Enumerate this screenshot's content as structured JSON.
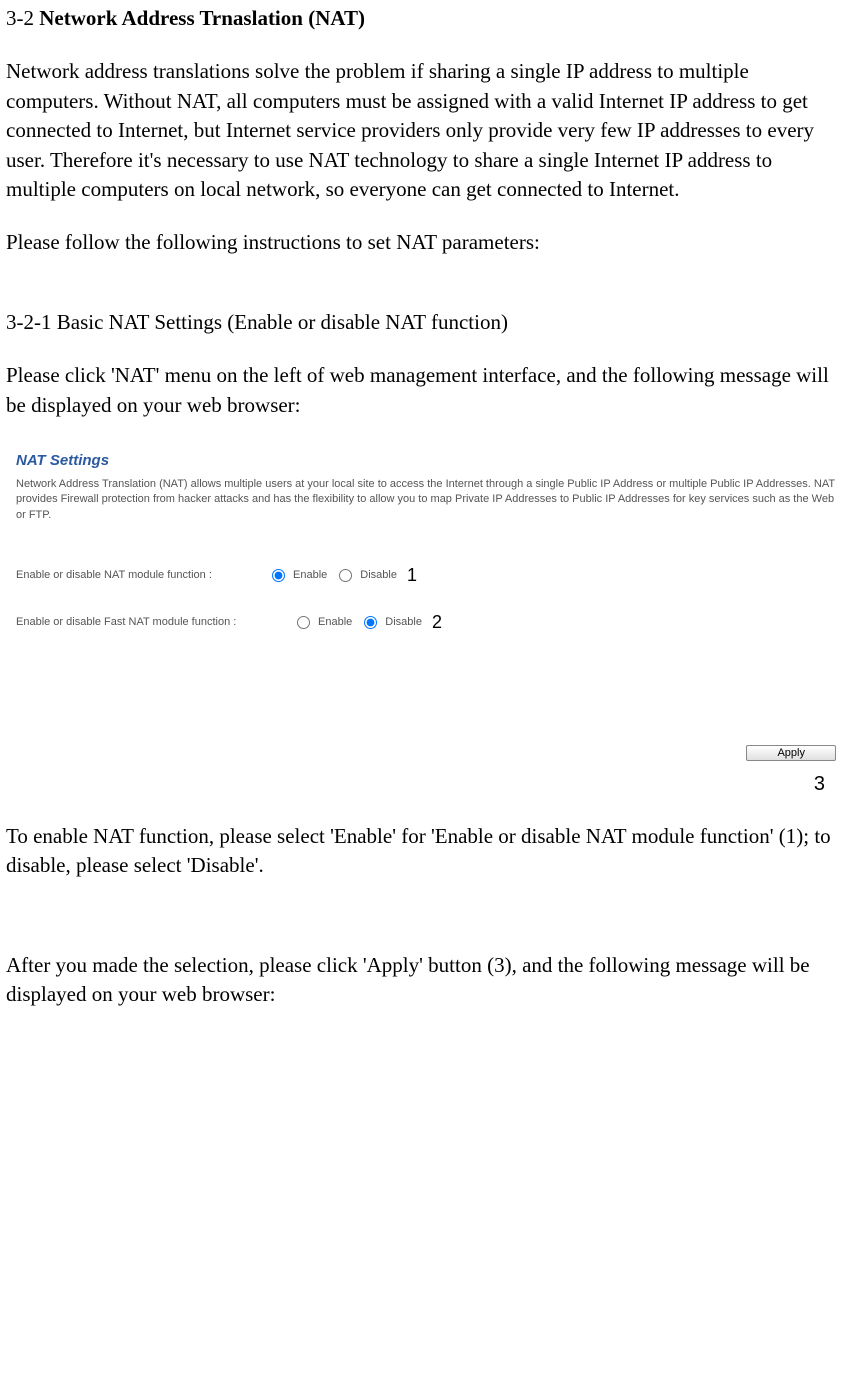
{
  "heading": {
    "number": "3-2 ",
    "title": "Network Address Trnaslation (NAT)"
  },
  "para1": "Network address translations solve the problem if sharing a single IP address to multiple computers. Without NAT, all computers must be assigned with a valid Internet IP address to get connected to Internet, but Internet service providers only provide very few IP addresses to every user. Therefore it's necessary to use NAT technology to share a single Internet IP address to multiple computers on local network, so everyone can get connected to Internet.",
  "para2": "Please follow the following instructions to set NAT parameters:",
  "subheading": "3-2-1 Basic NAT Settings (Enable or disable NAT function)",
  "para3": "Please click 'NAT' menu on the left of web management interface, and the following message will be displayed on your web browser:",
  "screenshot": {
    "title": "NAT Settings",
    "description": "Network Address Translation (NAT) allows multiple users at your local site to access the Internet through a single Public IP Address or multiple Public IP Addresses. NAT provides Firewall protection from hacker attacks and has the flexibility to allow you to map Private IP Addresses to Public IP Addresses for key services such as the Web or FTP.",
    "row1_label": "Enable or disable NAT module function :",
    "row2_label": "Enable or disable Fast NAT module function :",
    "enable_text": "Enable",
    "disable_text": "Disable",
    "annotation1": "1",
    "annotation2": "2",
    "apply_label": "Apply",
    "annotation3": "3"
  },
  "para4": "To enable NAT function, please select 'Enable' for 'Enable or disable NAT module function' (1); to disable, please select 'Disable'.",
  "para5": "After you made the selection, please click 'Apply' button (3), and the following message will be displayed on your web browser:"
}
